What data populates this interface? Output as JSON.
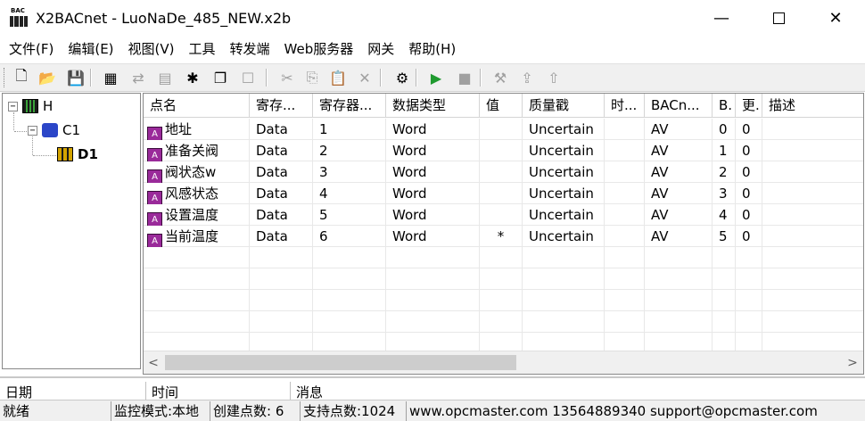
{
  "window": {
    "title": "X2BACnet - LuoNaDe_485_NEW.x2b",
    "icon_label": "BAC",
    "controls": [
      "minimize",
      "maximize",
      "close"
    ]
  },
  "menu": [
    "文件(F)",
    "编辑(E)",
    "视图(V)",
    "工具",
    "转发端",
    "Web服务器",
    "网关",
    "帮助(H)"
  ],
  "toolbar": {
    "buttons": [
      {
        "name": "new-icon",
        "glyph": "🗋",
        "enabled": true
      },
      {
        "name": "open-folder-icon",
        "glyph": "📂",
        "enabled": true
      },
      {
        "name": "save-icon",
        "glyph": "💾",
        "enabled": false
      },
      {
        "name": "add-host-icon",
        "glyph": "▦",
        "enabled": true
      },
      {
        "name": "add-channel-icon",
        "glyph": "⇄",
        "enabled": false
      },
      {
        "name": "add-device-icon",
        "glyph": "▤",
        "enabled": false
      },
      {
        "name": "add-point-icon",
        "glyph": "✱",
        "enabled": true
      },
      {
        "name": "batch-point-icon",
        "glyph": "❐",
        "enabled": true
      },
      {
        "name": "properties-icon",
        "glyph": "☐",
        "enabled": false
      },
      {
        "name": "cut-icon",
        "glyph": "✂",
        "enabled": false
      },
      {
        "name": "copy-icon",
        "glyph": "⎘",
        "enabled": false
      },
      {
        "name": "paste-icon",
        "glyph": "📋",
        "enabled": false
      },
      {
        "name": "delete-icon",
        "glyph": "✕",
        "enabled": false
      },
      {
        "name": "monitor-icon",
        "glyph": "⚙",
        "enabled": true
      },
      {
        "name": "run-icon",
        "glyph": "▶",
        "enabled": true
      },
      {
        "name": "stop-icon",
        "glyph": "■",
        "enabled": false
      },
      {
        "name": "tools-icon",
        "glyph": "⚒",
        "enabled": false
      },
      {
        "name": "load-icon",
        "glyph": "⇪",
        "enabled": false
      },
      {
        "name": "upload-icon",
        "glyph": "⇧",
        "enabled": false
      }
    ]
  },
  "tree": {
    "host": {
      "label": "H",
      "expander": "⊟"
    },
    "channel": {
      "label": "C1",
      "expander": "⊟"
    },
    "device": {
      "label": "D1"
    }
  },
  "table": {
    "columns": [
      "点名",
      "寄存...",
      "寄存器...",
      "数据类型",
      "值",
      "质量戳",
      "时...",
      "BACn...",
      "B.",
      "更.",
      "描述"
    ],
    "rows": [
      [
        "地址",
        "Data",
        "1",
        "Word",
        "",
        "Uncertain",
        "",
        "AV",
        "0",
        "0",
        ""
      ],
      [
        "准备关阀",
        "Data",
        "2",
        "Word",
        "",
        "Uncertain",
        "",
        "AV",
        "1",
        "0",
        ""
      ],
      [
        "阀状态w",
        "Data",
        "3",
        "Word",
        "",
        "Uncertain",
        "",
        "AV",
        "2",
        "0",
        ""
      ],
      [
        "风感状态",
        "Data",
        "4",
        "Word",
        "",
        "Uncertain",
        "",
        "AV",
        "3",
        "0",
        ""
      ],
      [
        "设置温度",
        "Data",
        "5",
        "Word",
        "",
        "Uncertain",
        "",
        "AV",
        "4",
        "0",
        ""
      ],
      [
        "当前温度",
        "Data",
        "6",
        "Word",
        "*",
        "Uncertain",
        "",
        "AV",
        "5",
        "0",
        ""
      ]
    ],
    "scroll_left": "<",
    "scroll_right": ">"
  },
  "log": {
    "columns": [
      "日期",
      "时间",
      "消息"
    ]
  },
  "status": {
    "ready": "就绪",
    "mode": "监控模式:本地",
    "created": "创建点数: 6",
    "supported": "支持点数:1024",
    "contact": "www.opcmaster.com 13564889340 support@opcmaster.com"
  }
}
